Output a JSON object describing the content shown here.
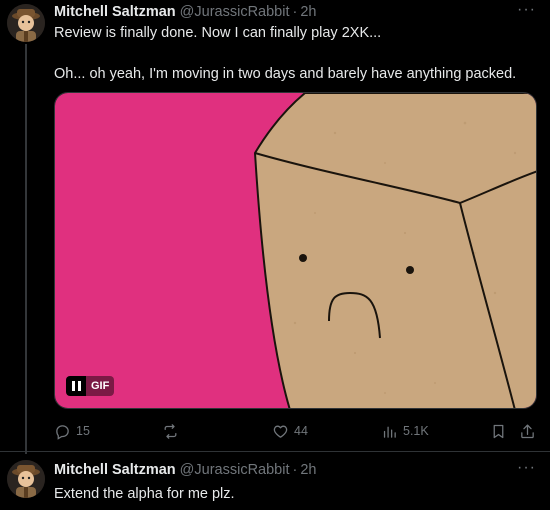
{
  "tweets": [
    {
      "author_name": "Mitchell Saltzman",
      "handle": "@JurassicRabbit",
      "separator": "·",
      "time": "2h",
      "more_label": "···",
      "text_lines": [
        "Review is finally done. Now I can finally play 2XK...",
        "Oh... oh yeah, I'm moving in two days and barely have anything packed."
      ],
      "media": {
        "type": "gif",
        "badge_label": "GIF",
        "pause_icon": "pause-icon",
        "background_color": "#e0307f",
        "box_color": "#c9a77f"
      },
      "stats": {
        "replies": "15",
        "reposts": "",
        "likes": "44",
        "views": "5.1K"
      }
    },
    {
      "author_name": "Mitchell Saltzman",
      "handle": "@JurassicRabbit",
      "separator": "·",
      "time": "2h",
      "more_label": "···",
      "text_lines": [
        "Extend the alpha for me plz."
      ]
    }
  ],
  "colors": {
    "background": "#000000",
    "primary_text": "#e7e9ea",
    "secondary_text": "#71767b",
    "divider": "#2f3336"
  },
  "icons": [
    "reply-icon",
    "repost-icon",
    "like-icon",
    "views-icon",
    "bookmark-icon",
    "share-icon"
  ]
}
